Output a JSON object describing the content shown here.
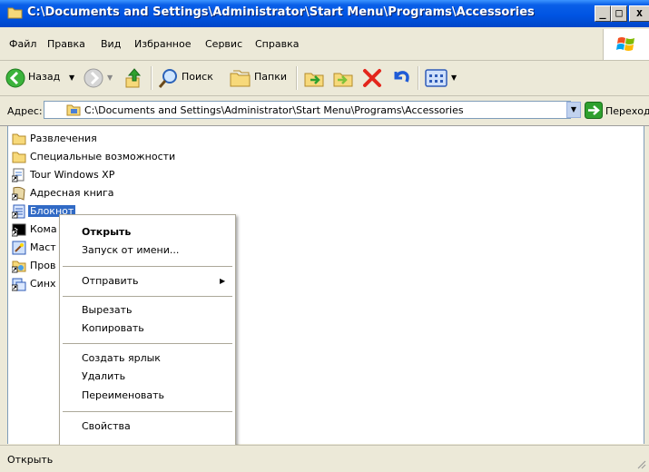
{
  "window": {
    "title": "C:\\Documents and Settings\\Administrator\\Start Menu\\Programs\\Accessories",
    "controls": {
      "minimize": "_",
      "maximize": "□",
      "close": "x"
    }
  },
  "menubar": {
    "items": [
      "Файл",
      "Правка",
      "Вид",
      "Избранное",
      "Сервис",
      "Справка"
    ]
  },
  "toolbar": {
    "back_label": "Назад",
    "search_label": "Поиск",
    "folders_label": "Папки",
    "icons": [
      "back-arrow-icon",
      "forward-arrow-icon",
      "up-folder-icon",
      "search-icon",
      "folders-icon",
      "move-to-icon",
      "copy-to-icon",
      "delete-icon",
      "undo-icon",
      "views-icon"
    ]
  },
  "addressbar": {
    "label": "Адрес:",
    "value": "C:\\Documents and Settings\\Administrator\\Start Menu\\Programs\\Accessories",
    "go_label": "Переход"
  },
  "files": [
    {
      "label": "Развлечения",
      "icon": "folder-icon"
    },
    {
      "label": "Специальные возможности",
      "icon": "folder-icon"
    },
    {
      "label": "Tour Windows XP",
      "icon": "shortcut-icon"
    },
    {
      "label": "Адресная книга",
      "icon": "address-book-icon"
    },
    {
      "label": "Блокнот",
      "icon": "notepad-icon",
      "selected": true
    },
    {
      "label": "Кома",
      "icon": "command-prompt-icon"
    },
    {
      "label": "Маст",
      "icon": "wizard-icon"
    },
    {
      "label": "Пров",
      "icon": "explorer-icon"
    },
    {
      "label": "Синх",
      "icon": "sync-icon"
    }
  ],
  "context_menu": {
    "items": [
      {
        "label": "Открыть",
        "bold": true
      },
      {
        "label": "Запуск от имени..."
      },
      {
        "label": "Отправить",
        "submenu": true
      },
      {
        "label": "Вырезать"
      },
      {
        "label": "Копировать"
      },
      {
        "label": "Создать ярлык"
      },
      {
        "label": "Удалить"
      },
      {
        "label": "Переименовать"
      },
      {
        "label": "Свойства"
      }
    ],
    "submenu_arrow": "▶"
  },
  "statusbar": {
    "text": "Открыть"
  },
  "colors": {
    "titlebar": "#0054e3",
    "selection": "#316ac5",
    "chrome": "#ece9d8"
  }
}
